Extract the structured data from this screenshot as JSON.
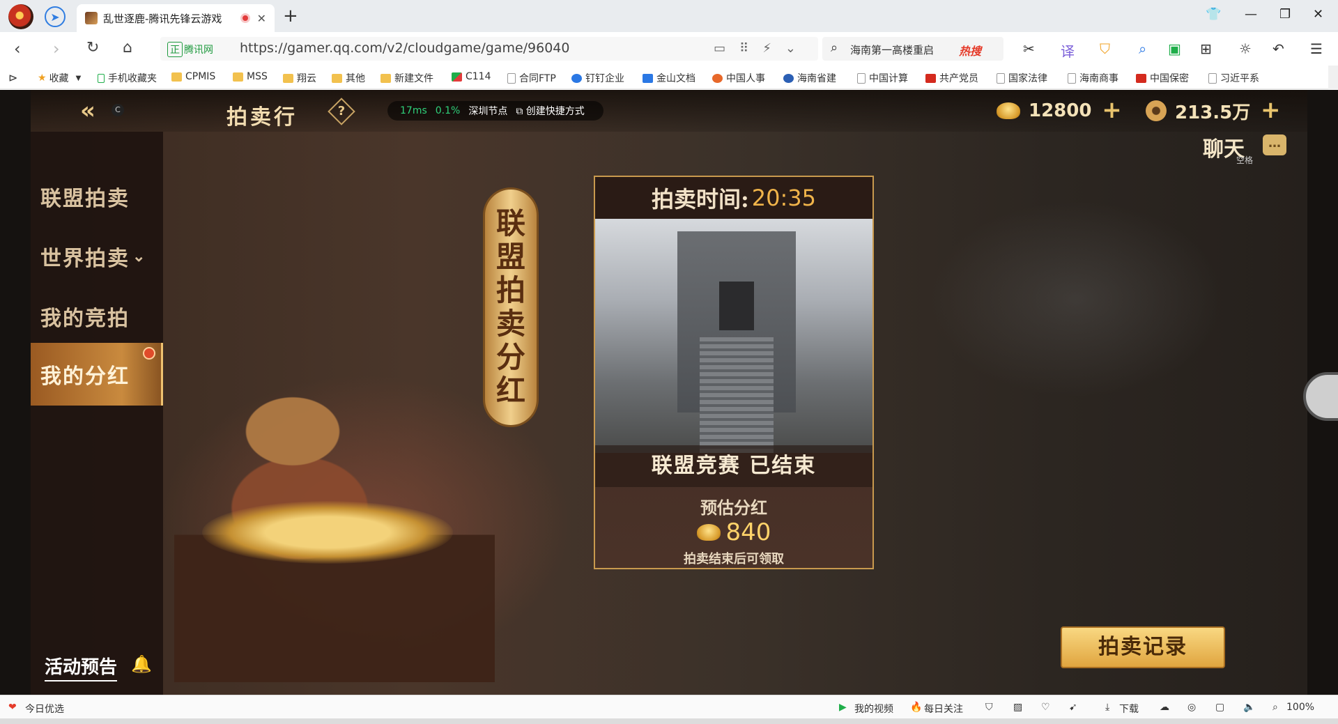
{
  "browser": {
    "tab_title": "乱世逐鹿-腾讯先锋云游戏",
    "new_tab": "+",
    "secure_badge": "正",
    "site_name": "腾讯网",
    "url": "https://gamer.qq.com/v2/cloudgame/game/96040",
    "search_text": "海南第一高楼重启",
    "hot_search": "热搜",
    "zoom": "100%"
  },
  "bookmarks": [
    {
      "label": "收藏",
      "kind": "star"
    },
    {
      "label": "手机收藏夹",
      "kind": "folder"
    },
    {
      "label": "CPMIS",
      "kind": "folder"
    },
    {
      "label": "MSS",
      "kind": "folder"
    },
    {
      "label": "翔云",
      "kind": "folder"
    },
    {
      "label": "其他",
      "kind": "folder"
    },
    {
      "label": "新建文件",
      "kind": "folder"
    },
    {
      "label": "C114",
      "kind": "site"
    },
    {
      "label": "合同FTP",
      "kind": "page"
    },
    {
      "label": "钉钉企业",
      "kind": "site"
    },
    {
      "label": "金山文档",
      "kind": "site"
    },
    {
      "label": "中国人事",
      "kind": "site"
    },
    {
      "label": "海南省建",
      "kind": "site"
    },
    {
      "label": "中国计算",
      "kind": "page"
    },
    {
      "label": "共产党员",
      "kind": "site"
    },
    {
      "label": "国家法律",
      "kind": "page"
    },
    {
      "label": "海南商事",
      "kind": "page"
    },
    {
      "label": "中国保密",
      "kind": "site"
    },
    {
      "label": "习近平系",
      "kind": "page"
    }
  ],
  "game": {
    "title": "拍卖行",
    "back_hint": "C",
    "help": "?",
    "ping": "17ms",
    "loss": "0.1%",
    "node": "深圳节点",
    "shortcut": "创建快捷方式",
    "gold": "12800",
    "coins": "213.5万",
    "chat": "聊天",
    "chat_key": "空格",
    "sidebar": [
      "联盟拍卖",
      "世界拍卖",
      "我的竞拍",
      "我的分红"
    ],
    "event_preview": "活动预告",
    "banner": [
      "联",
      "盟",
      "拍",
      "卖",
      "分",
      "红"
    ],
    "card": {
      "time_label": "拍卖时间:",
      "time": "20:35",
      "status": "联盟竞赛 已结束",
      "dividend_label": "预估分红",
      "dividend_value": "840",
      "note": "拍卖结束后可领取"
    },
    "record_button": "拍卖记录"
  },
  "statusbar": {
    "today": "今日优选",
    "video": "我的视频",
    "daily": "每日关注",
    "download": "下载"
  },
  "colors": {
    "accent_gold": "#f0b44a",
    "green_ping": "#2fd07a",
    "active_tab": "#c98a3e"
  }
}
